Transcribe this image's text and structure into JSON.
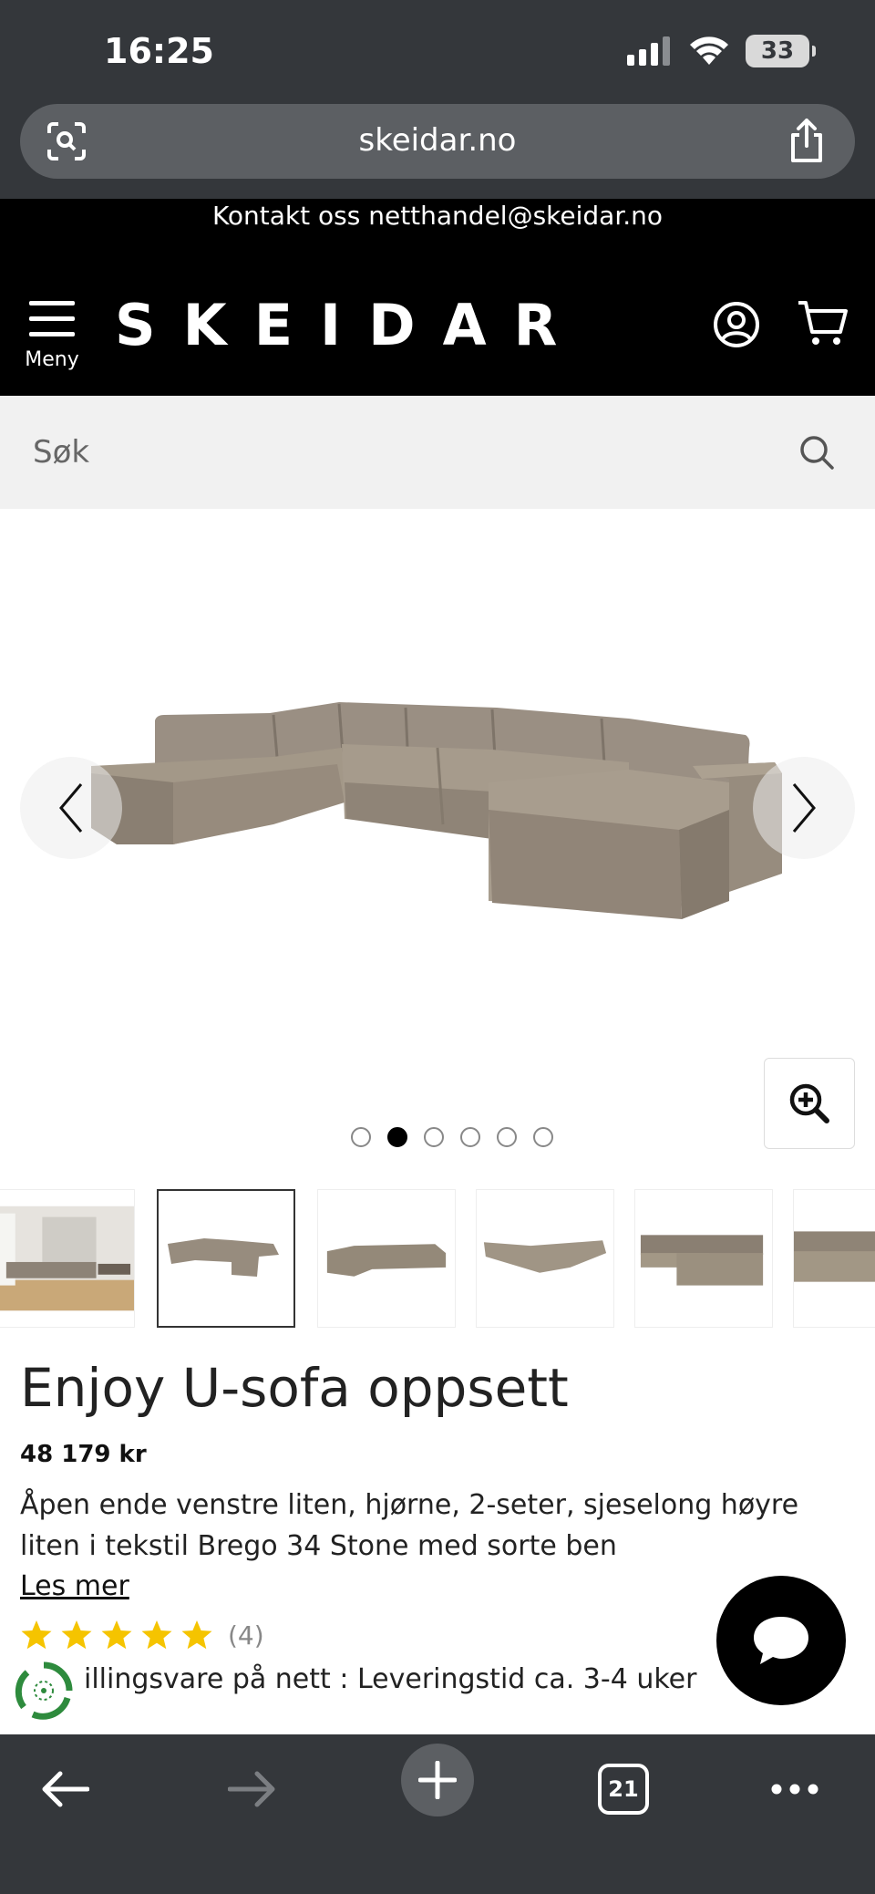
{
  "status_bar": {
    "time": "16:25",
    "battery": "33"
  },
  "url_bar": {
    "domain": "skeidar.no"
  },
  "site": {
    "contact": "Kontakt oss netthandel@skeidar.no",
    "logo": "SKEIDAR",
    "menu_label": "Meny"
  },
  "search": {
    "placeholder": "Søk"
  },
  "gallery": {
    "image_count": 6,
    "active_index": 1
  },
  "product": {
    "title": "Enjoy U-sofa oppsett",
    "price": "48 179 kr",
    "description": "Åpen ende venstre liten, hjørne, 2-seter, sjeselong høyre liten i tekstil Brego 34 Stone med sorte ben",
    "read_more": "Les mer",
    "rating": 5,
    "rating_count": "(4)",
    "delivery": "illingsvare på nett : Leveringstid ca. 3-4 uker"
  },
  "toolbar": {
    "tab_count": "21"
  },
  "colors": {
    "chrome": "#34373b",
    "header": "#000000",
    "star": "#f5c400",
    "delivery_green": "#2e8b3d"
  }
}
